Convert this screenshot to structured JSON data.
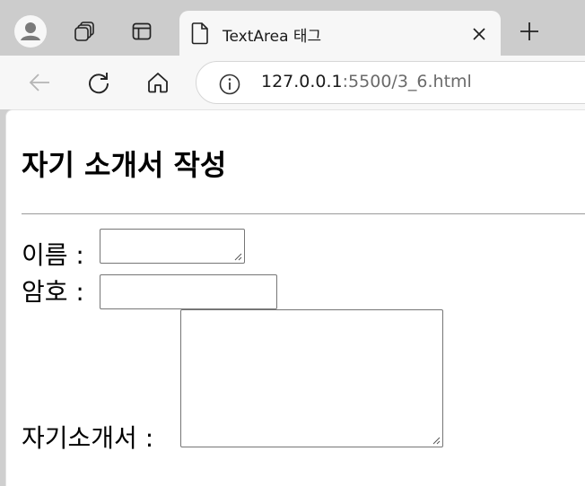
{
  "browser": {
    "tab": {
      "title": "TextArea 태그"
    },
    "address": {
      "host": "127.0.0.1",
      "rest": ":5500/3_6.html"
    }
  },
  "page": {
    "heading": "자기 소개서 작성",
    "form": {
      "name_label": "이름 :",
      "password_label": "암호 :",
      "intro_label": "자기소개서 :"
    }
  },
  "icons": {
    "avatar": "profile-icon",
    "workspaces": "workspaces-icon",
    "tab_actions": "tab-actions-icon",
    "tab_page": "page-icon",
    "tab_close": "close-icon",
    "new_tab": "plus-icon",
    "back": "back-arrow-icon",
    "reload": "reload-icon",
    "home": "home-icon",
    "site_info": "info-icon"
  }
}
